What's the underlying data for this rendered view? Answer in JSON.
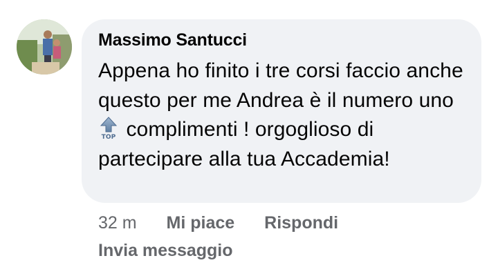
{
  "comment": {
    "author": "Massimo Santucci",
    "text_before_emoji": "Appena ho finito i tre corsi faccio anche questo per me Andrea è il numero uno",
    "emoji": "top-arrow-emoji",
    "text_after_emoji": "complimenti ! orgoglioso di partecipare alla tua Accademia!",
    "time": "32 m",
    "like_label": "Mi piace",
    "reply_label": "Rispondi",
    "send_message_label": "Invia messaggio"
  },
  "colors": {
    "bubble_bg": "#f0f2f5",
    "text": "#050505",
    "secondary_text": "#65676b"
  }
}
